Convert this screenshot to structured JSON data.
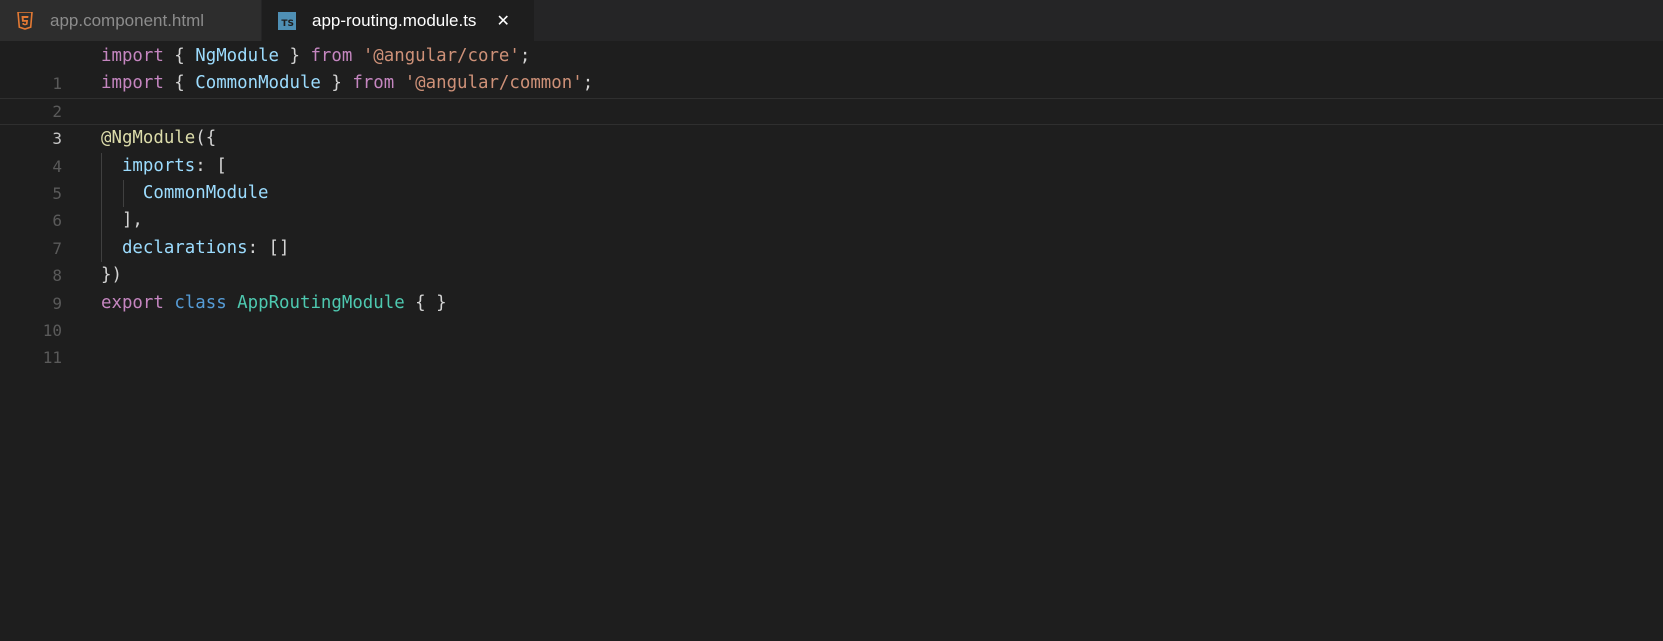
{
  "tabs": [
    {
      "label": "app.component.html",
      "icon": "html5-icon",
      "active": false
    },
    {
      "label": "app-routing.module.ts",
      "icon": "typescript-icon",
      "icon_text": "TS",
      "active": true,
      "close": "✕"
    }
  ],
  "colors": {
    "background": "#1e1e1e",
    "tabbar": "#252526",
    "keyword": "#c586c0",
    "storage": "#569cd6",
    "string": "#ce9178",
    "variable": "#9cdcfe",
    "class": "#4ec9b0",
    "decorator": "#dcdcaa",
    "html_icon": "#e37933",
    "ts_icon": "#4f8fb4"
  },
  "editor": {
    "current_line": 3,
    "lines": [
      {
        "num": "1",
        "tokens": [
          "import",
          " { ",
          "NgModule",
          " } ",
          "from",
          " ",
          "'@angular/core'",
          ";"
        ]
      },
      {
        "num": "2",
        "tokens": [
          "import",
          " { ",
          "CommonModule",
          " } ",
          "from",
          " ",
          "'@angular/common'",
          ";"
        ]
      },
      {
        "num": "3",
        "tokens": []
      },
      {
        "num": "4",
        "tokens": [
          "@NgModule",
          "({"
        ]
      },
      {
        "num": "5",
        "tokens": [
          "  ",
          "imports",
          ": ["
        ]
      },
      {
        "num": "6",
        "tokens": [
          "    ",
          "CommonModule"
        ]
      },
      {
        "num": "7",
        "tokens": [
          "  ],"
        ]
      },
      {
        "num": "8",
        "tokens": [
          "  ",
          "declarations",
          ": []"
        ]
      },
      {
        "num": "9",
        "tokens": [
          "})"
        ]
      },
      {
        "num": "10",
        "tokens": [
          "export",
          " ",
          "class",
          " ",
          "AppRoutingModule",
          " { }"
        ]
      },
      {
        "num": "11",
        "tokens": []
      }
    ]
  }
}
